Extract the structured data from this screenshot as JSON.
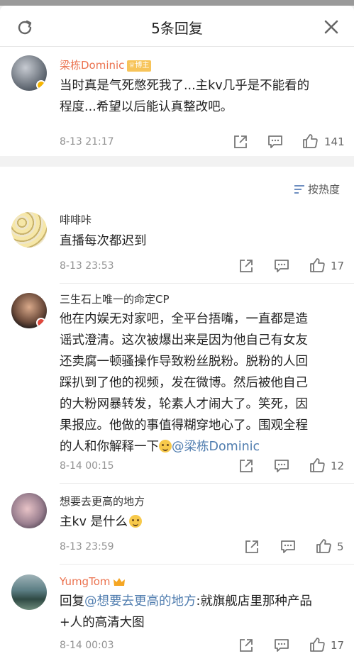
{
  "header": {
    "title": "5条回复"
  },
  "root_comment": {
    "user": "梁栋Dominic",
    "badge": "博主",
    "text_line1": "当时真是气死憋死我了...主kv几乎是不能看的",
    "text_line2": "程度...希望以后能认真整改吧。",
    "time": "8-13 21:17",
    "likes": "141"
  },
  "sort": {
    "label": "按热度"
  },
  "replies": [
    {
      "user": "啡啡咔",
      "text": "直播每次都迟到",
      "time": "8-13 23:53",
      "likes": "17"
    },
    {
      "user": "三生石上唯一的命定CP",
      "lines": [
        "他在内娱无对家吧，全平台捂嘴，一直都是造",
        "谣式澄清。这次被爆出来是因为他自己有女友",
        "还卖腐一顿骚操作导致粉丝脱粉。脱粉的人回",
        "踩扒到了他的视频，发在微博。然后被他自己",
        "的大粉网暴转发，轮素人才闹大了。笑死，因",
        "果报应。他做的事值得糊穿地心了。围观全程"
      ],
      "last_prefix": "的人和你解释一下",
      "mention": "@梁栋Dominic",
      "time": "8-14 00:15",
      "likes": "12"
    },
    {
      "user": "想要去更高的地方",
      "text": "主kv 是什么",
      "time": "8-13 23:59",
      "likes": "5"
    },
    {
      "user": "YumgTom",
      "prefix": "回复",
      "mention": "@想要去更高的地方",
      "line1_rest": ":就旗舰店里那种产品",
      "line2": "+人的高清大图",
      "time": "8-14 00:03",
      "likes": "17"
    }
  ],
  "colors": {
    "accent_orange": "#eb7350",
    "link_blue": "#507daf",
    "badge_gold": "#f7c45a"
  }
}
